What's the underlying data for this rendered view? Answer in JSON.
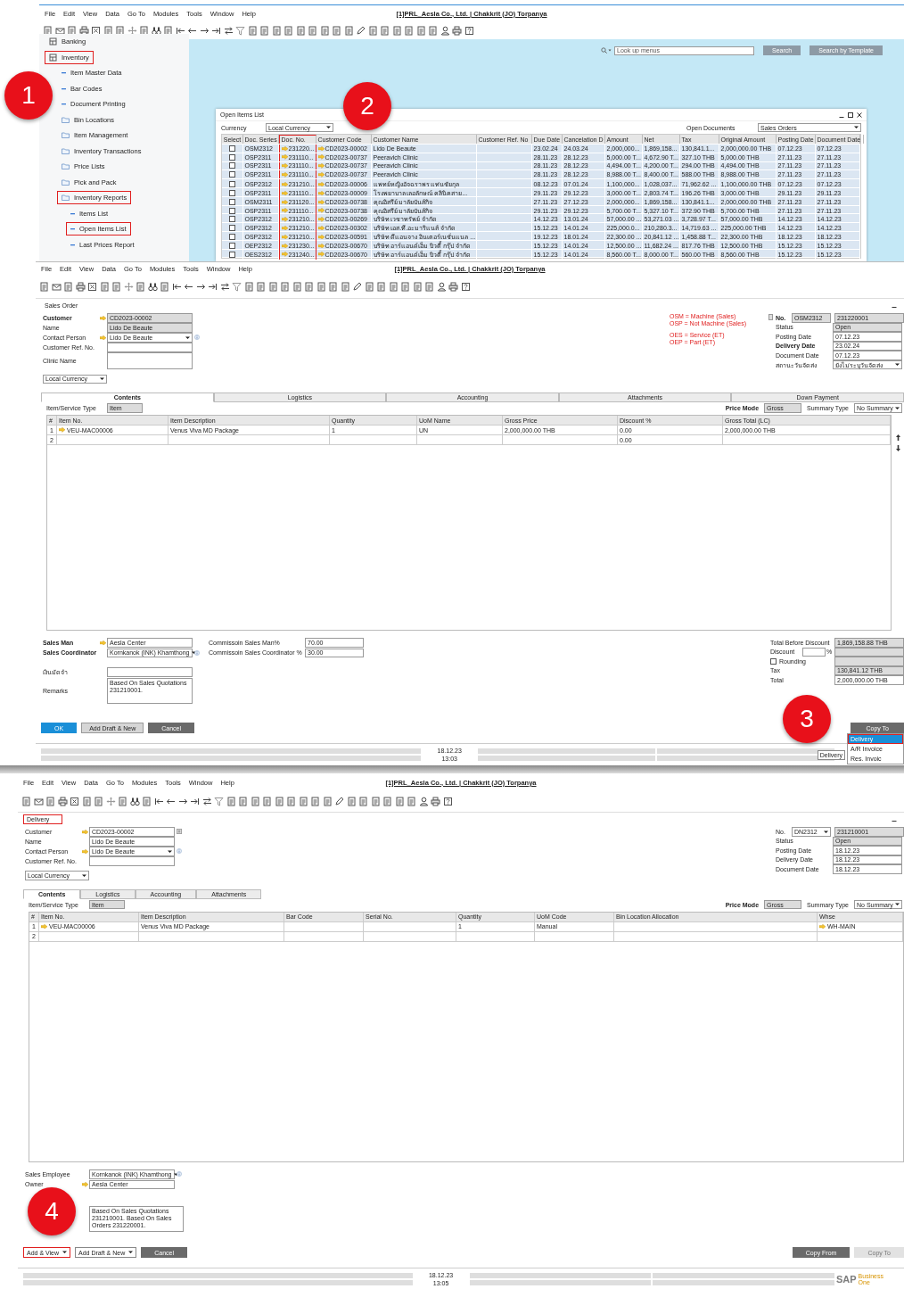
{
  "callouts": [
    {
      "text": "1"
    },
    {
      "text": "2"
    },
    {
      "text": "3"
    },
    {
      "text": "4"
    }
  ],
  "main_menu_screen": {
    "menu_bar": [
      "File",
      "Edit",
      "View",
      "Data",
      "Go To",
      "Modules",
      "Tools",
      "Window",
      "Help"
    ],
    "title": "[1]PRL_Aesla Co., Ltd. | Chakkrit (JO) Torpanya",
    "sidebar": {
      "items": [
        {
          "label": "Banking",
          "kind": "module",
          "highlighted": false
        },
        {
          "label": "Inventory",
          "kind": "module",
          "highlighted": true,
          "children": [
            {
              "label": "Item Master Data",
              "kind": "leaf",
              "highlighted": false
            },
            {
              "label": "Bar Codes",
              "kind": "leaf",
              "highlighted": false
            },
            {
              "label": "Document Printing",
              "kind": "leaf",
              "highlighted": false
            },
            {
              "label": "Bin Locations",
              "kind": "folder",
              "highlighted": false
            },
            {
              "label": "Item Management",
              "kind": "folder",
              "highlighted": false
            },
            {
              "label": "Inventory Transactions",
              "kind": "folder",
              "highlighted": false
            },
            {
              "label": "Price Lists",
              "kind": "folder",
              "highlighted": false
            },
            {
              "label": "Pick and Pack",
              "kind": "folder",
              "highlighted": false
            },
            {
              "label": "Inventory Reports",
              "kind": "folder",
              "highlighted": true,
              "children": [
                {
                  "label": "Items List",
                  "kind": "leaf",
                  "highlighted": false
                },
                {
                  "label": "Open Items List",
                  "kind": "leaf",
                  "highlighted": true
                },
                {
                  "label": "Last Prices Report",
                  "kind": "leaf",
                  "highlighted": false
                }
              ]
            }
          ]
        }
      ]
    },
    "search": {
      "placeholder": "Look up menus",
      "buttons": [
        "Search",
        "Search by Template"
      ]
    },
    "open_items_window": {
      "title": "Open Items List",
      "currency_label": "Currency",
      "currency": "Local Currency",
      "open_documents_label": "Open Documents",
      "open_documents": "Sales Orders",
      "columns": [
        {
          "label": "Select",
          "kind": "check",
          "highlighted": false
        },
        {
          "label": "Doc. Series",
          "kind": "text",
          "highlighted": false
        },
        {
          "label": "Doc. No.",
          "kind": "link",
          "highlighted": true
        },
        {
          "label": "Customer Code",
          "kind": "link",
          "highlighted": false
        },
        {
          "label": "Customer Name",
          "kind": "text",
          "highlighted": false
        },
        {
          "label": "Customer Ref. No",
          "kind": "text",
          "highlighted": false
        },
        {
          "label": "Due Date",
          "kind": "text",
          "highlighted": false
        },
        {
          "label": "Cancelation D",
          "kind": "text",
          "highlighted": false
        },
        {
          "label": "Amount",
          "kind": "text",
          "highlighted": false
        },
        {
          "label": "Net",
          "kind": "text",
          "highlighted": false
        },
        {
          "label": "Tax",
          "kind": "text",
          "highlighted": false
        },
        {
          "label": "Original Amount",
          "kind": "text",
          "highlighted": false
        },
        {
          "label": "Posting Date",
          "kind": "text",
          "highlighted": false
        },
        {
          "label": "Document Date",
          "kind": "text",
          "highlighted": false
        }
      ],
      "rows": [
        {
          "checked": false,
          "cells": [
            "",
            "OSM2312",
            "231220...",
            "CD2023-00002",
            "Lido De Beaute",
            "",
            "23.02.24",
            "24.03.24",
            "2,000,000...",
            "1,869,158...",
            "130,841.1...",
            "2,000,000.00 THB",
            "07.12.23",
            "07.12.23"
          ]
        },
        {
          "checked": false,
          "cells": [
            "",
            "OSP2311",
            "231110...",
            "CD2023-00737",
            "Peeravich Clinic",
            "",
            "28.11.23",
            "28.12.23",
            "5,000.00 T...",
            "4,672.90 T...",
            "327.10 THB",
            "5,000.00 THB",
            "27.11.23",
            "27.11.23"
          ]
        },
        {
          "checked": false,
          "cells": [
            "",
            "OSP2311",
            "231110...",
            "CD2023-00737",
            "Peeravich Clinic",
            "",
            "28.11.23",
            "28.12.23",
            "4,494.00 T...",
            "4,200.00 T...",
            "294.00 THB",
            "4,494.00 THB",
            "27.11.23",
            "27.11.23"
          ]
        },
        {
          "checked": false,
          "cells": [
            "",
            "OSP2311",
            "231110...",
            "CD2023-00737",
            "Peeravich Clinic",
            "",
            "28.11.23",
            "28.12.23",
            "8,988.00 T...",
            "8,400.00 T...",
            "588.00 THB",
            "8,988.00 THB",
            "27.11.23",
            "27.11.23"
          ]
        },
        {
          "checked": false,
          "cells": [
            "",
            "OSP2312",
            "231210...",
            "CD2023-00006",
            "แพทย์หญิงอัจฉราพร แท่นชัยกุล",
            "",
            "08.12.23",
            "07.01.24",
            "1,100,000...",
            "1,028,037...",
            "71,962.62 ...",
            "1,100,000.00 THB",
            "07.12.23",
            "07.12.23"
          ]
        },
        {
          "checked": false,
          "cells": [
            "",
            "OSP2311",
            "231110...",
            "CD2023-00009",
            "โรงพยาบาล เลอลักษณ์ คลินิคสาย...",
            "",
            "29.11.23",
            "29.12.23",
            "3,000.00 T...",
            "2,803.74 T...",
            "196.26 THB",
            "3,000.00 THB",
            "29.11.23",
            "29.11.23"
          ]
        },
        {
          "checked": false,
          "cells": [
            "",
            "OSM2311",
            "231120...",
            "CD2023-00738",
            "คุณอิสรีย์ มาลัยบันส์กิจ",
            "",
            "27.11.23",
            "27.12.23",
            "2,000,000...",
            "1,869,158...",
            "130,841.1...",
            "2,000,000.00 THB",
            "27.11.23",
            "27.11.23"
          ]
        },
        {
          "checked": false,
          "cells": [
            "",
            "OSP2311",
            "231110...",
            "CD2023-00738",
            "คุณอิสรีย์ มาลัยบันส์กิจ",
            "",
            "29.11.23",
            "29.12.23",
            "5,700.00 T...",
            "5,327.10 T...",
            "372.90 THB",
            "5,700.00 THB",
            "27.11.23",
            "27.11.23"
          ]
        },
        {
          "checked": false,
          "cells": [
            "",
            "OSP2312",
            "231210...",
            "CD2023-00269",
            "บริษัท เวชาทรัพย์ จำกัด",
            "",
            "14.12.23",
            "13.01.24",
            "57,000.00 ...",
            "53,271.03 ...",
            "3,728.97 T...",
            "57,000.00 THB",
            "14.12.23",
            "14.12.23"
          ]
        },
        {
          "checked": false,
          "cells": [
            "",
            "OSP2312",
            "231210...",
            "CD2023-00302",
            "บริษัท เอส.ที.อะมาริแนส์ จำกัด",
            "",
            "15.12.23",
            "14.01.24",
            "225,000.0...",
            "210,280.3...",
            "14,719.63 ...",
            "225,000.00 THB",
            "14.12.23",
            "14.12.23"
          ]
        },
        {
          "checked": false,
          "cells": [
            "",
            "OSP2312",
            "231210...",
            "CD2023-00591",
            "บริษัท ดีแอนจาง อินเตอร์เนชั่นแนล ...",
            "",
            "19.12.23",
            "18.01.24",
            "22,300.00 ...",
            "20,841.12 ...",
            "1,458.88 T...",
            "22,300.00 THB",
            "18.12.23",
            "18.12.23"
          ]
        },
        {
          "checked": false,
          "cells": [
            "",
            "OEP2312",
            "231230...",
            "CD2023-00670",
            "บริษัท อาร์แอนด์เอ็ม บิวตี้ กรุ๊ป จำกัด",
            "",
            "15.12.23",
            "14.01.24",
            "12,500.00 ...",
            "11,682.24 ...",
            "817.76 THB",
            "12,500.00 THB",
            "15.12.23",
            "15.12.23"
          ]
        },
        {
          "checked": false,
          "cells": [
            "",
            "OES2312",
            "231240...",
            "CD2023-00670",
            "บริษัท อาร์แอนด์เอ็ม บิวตี้ กรุ๊ป จำกัด",
            "",
            "15.12.23",
            "14.01.24",
            "8,560.00 T...",
            "8,000.00 T...",
            "560.00 THB",
            "8,560.00 THB",
            "15.12.23",
            "15.12.23"
          ]
        }
      ]
    }
  },
  "sales_order_screen": {
    "menu_bar": [
      "File",
      "Edit",
      "View",
      "Data",
      "Go To",
      "Modules",
      "Tools",
      "Window",
      "Help"
    ],
    "title": "[1]PRL_Aesla Co., Ltd. | Chakkrit (JO) Torpanya",
    "window_title": "Sales Order",
    "window_title_highlighted": false,
    "header_left": [
      {
        "label": "Customer",
        "bold": true,
        "kind": "link",
        "value": "CD2023-00002"
      },
      {
        "label": "Name",
        "bold": false,
        "kind": "display",
        "value": "Lido De Beaute"
      },
      {
        "label": "Contact Person",
        "bold": false,
        "kind": "link_dropdown",
        "value": "Lido De Beaute"
      },
      {
        "label": "Customer Ref. No.",
        "bold": false,
        "kind": "input"
      },
      {
        "label": "Clinic Name",
        "bold": false,
        "kind": "textarea"
      }
    ],
    "currency": "Local Currency",
    "notes": [
      {
        "text": "OSM = Machine (Sales)"
      },
      {
        "text": "OSP = Not Machine (Sales)"
      },
      {
        "text": "OES = Service (ET)"
      },
      {
        "text": "OEP = Part (ET)"
      }
    ],
    "header_right": [
      {
        "label": "No.",
        "bold": true,
        "kind": "series",
        "series": "OSM2312",
        "value": "231220001"
      },
      {
        "label": "Status",
        "bold": false,
        "kind": "display",
        "value": "Open"
      },
      {
        "label": "Posting Date",
        "bold": false,
        "kind": "input",
        "value": "07.12.23"
      },
      {
        "label": "Delivery Date",
        "bold": true,
        "kind": "input",
        "value": "23.02.24"
      },
      {
        "label": "Document Date",
        "bold": false,
        "kind": "input",
        "value": "07.12.23"
      },
      {
        "label": "สถานะวันจัดส่ง",
        "bold": false,
        "kind": "dropdown",
        "value": "ยังไม่ระบุวันจัดส่ง"
      }
    ],
    "tabs": [
      {
        "label": "Contents",
        "selected": true
      },
      {
        "label": "Logistics",
        "selected": false
      },
      {
        "label": "Accounting",
        "selected": false
      },
      {
        "label": "Attachments",
        "selected": false
      },
      {
        "label": "Down Payment",
        "selected": false
      }
    ],
    "item_type_label": "Item/Service Type",
    "item_type": "Item",
    "price_mode_label": "Price Mode",
    "price_mode": "Gross",
    "summary_type_label": "Summary Type",
    "summary_type": "No Summary",
    "grid": {
      "columns": [
        {
          "label": "#",
          "kind": "index"
        },
        {
          "label": "Item No.",
          "kind": "link"
        },
        {
          "label": "Item Description",
          "kind": "text"
        },
        {
          "label": "Quantity",
          "kind": "text"
        },
        {
          "label": "UoM Name",
          "kind": "text"
        },
        {
          "label": "Gross Price",
          "kind": "text"
        },
        {
          "label": "Discount %",
          "kind": "text"
        },
        {
          "label": "Gross Total (LC)",
          "kind": "text"
        }
      ],
      "rows": [
        [
          "1",
          "VEU-MAC00006",
          "Venus Viva MD Package",
          "1",
          "UN",
          "2,000,000.00 THB",
          "0.00",
          "2,000,000.00 THB"
        ],
        [
          "2",
          "",
          "",
          "",
          "",
          "",
          "0.00",
          ""
        ]
      ]
    },
    "footer_left": [
      {
        "label": "Sales Man",
        "bold": true,
        "kind": "link_input",
        "value": "Aesla Center"
      },
      {
        "label": "Sales Coordinator",
        "bold": true,
        "kind": "dropdown_info",
        "value": "Kornkanok (INK) Khamthong"
      },
      {
        "label": "เงินมัดจำ",
        "bold": false,
        "kind": "input"
      },
      {
        "label": "Remarks",
        "bold": false,
        "kind": "textarea",
        "value": "Based On Sales Quotations 231210001."
      }
    ],
    "footer_middle": [
      {
        "label": "Commissoin Sales Man%",
        "bold": false,
        "kind": "input",
        "value": "70.00"
      },
      {
        "label": "Commissoin Sales Coordinator %",
        "bold": false,
        "kind": "input",
        "value": "30.00"
      }
    ],
    "totals": [
      {
        "label": "Total Before Discount",
        "kind": "display",
        "value": "1,869,158.88 THB"
      },
      {
        "label": "Discount",
        "kind": "percent",
        "unit": "%"
      },
      {
        "label": "Rounding",
        "kind": "checkbox",
        "checked": false
      },
      {
        "label": "Tax",
        "kind": "display",
        "value": "130,841.12 THB"
      },
      {
        "label": "Total",
        "kind": "input",
        "value": "2,000,000.00 THB"
      }
    ],
    "buttons": [
      {
        "label": "OK",
        "kind": "primary",
        "highlighted": false
      },
      {
        "label": "Add Draft & New",
        "kind": "secondary",
        "highlighted": false
      },
      {
        "label": "Cancel",
        "kind": "dark",
        "highlighted": false
      }
    ],
    "right_buttons": [
      {
        "label": "Copy To",
        "kind": "dark",
        "disabled": false
      }
    ],
    "copy_to_menu": [
      {
        "label": "Delivery",
        "selected": true,
        "highlighted": true
      },
      {
        "label": "A/R Invoice",
        "selected": false,
        "highlighted": false
      },
      {
        "label": "Res. Invoic",
        "selected": false,
        "highlighted": false
      }
    ],
    "tooltip": "Delivery",
    "status_bar": {
      "date": "18.12.23",
      "time": "13:03"
    }
  },
  "delivery_screen": {
    "menu_bar": [
      "File",
      "Edit",
      "View",
      "Data",
      "Go To",
      "Modules",
      "Tools",
      "Window",
      "Help"
    ],
    "title": "[1]PRL_Aesla Co., Ltd. | Chakkrit (JO) Torpanya",
    "window_title": "Delivery",
    "window_title_highlighted": true,
    "header_left": [
      {
        "label": "Customer",
        "kind": "link_list",
        "value": "CD2023-00002"
      },
      {
        "label": "Name",
        "kind": "input",
        "value": "Lido De Beaute"
      },
      {
        "label": "Contact Person",
        "kind": "link_dropdown",
        "value": "Lido De Beaute"
      },
      {
        "label": "Customer Ref. No.",
        "kind": "input"
      }
    ],
    "currency": "Local Currency",
    "header_right": [
      {
        "label": "No.",
        "kind": "series_dropdown",
        "series": "DN2312",
        "value": "231210001"
      },
      {
        "label": "Status",
        "kind": "display",
        "value": "Open"
      },
      {
        "label": "Posting Date",
        "kind": "input",
        "value": "18.12.23"
      },
      {
        "label": "Delivery Date",
        "kind": "input",
        "value": "18.12.23"
      },
      {
        "label": "Document Date",
        "kind": "input",
        "value": "18.12.23"
      }
    ],
    "tabs": [
      {
        "label": "Contents",
        "selected": true
      },
      {
        "label": "Logistics",
        "selected": false
      },
      {
        "label": "Accounting",
        "selected": false
      },
      {
        "label": "Attachments",
        "selected": false
      }
    ],
    "item_type_label": "Item/Service Type",
    "item_type": "Item",
    "price_mode_label": "Price Mode",
    "price_mode": "Gross",
    "summary_type_label": "Summary Type",
    "summary_type": "No Summary",
    "grid": {
      "columns": [
        {
          "label": "#",
          "kind": "index"
        },
        {
          "label": "Item No.",
          "kind": "link"
        },
        {
          "label": "Item Description",
          "kind": "text"
        },
        {
          "label": "Bar Code",
          "kind": "text"
        },
        {
          "label": "Serial No.",
          "kind": "text"
        },
        {
          "label": "Quantity",
          "kind": "text"
        },
        {
          "label": "UoM Code",
          "kind": "text"
        },
        {
          "label": "Bin Location Allocation",
          "kind": "text"
        },
        {
          "label": "Whse",
          "kind": "link"
        }
      ],
      "rows": [
        [
          "1",
          "VEU-MAC00006",
          "Venus Viva MD Package",
          "",
          "",
          "1",
          "Manual",
          "",
          "WH-MAIN"
        ],
        [
          "2",
          "",
          "",
          "",
          "",
          "",
          "",
          "",
          ""
        ]
      ]
    },
    "footer_left": [
      {
        "label": "Sales Employee",
        "kind": "dropdown_info",
        "value": "Kornkanok (INK) Khamthong"
      },
      {
        "label": "Owner",
        "kind": "link_input",
        "value": "Aesla Center"
      },
      {
        "kind": "textarea",
        "value": "Based On Sales Quotations 231210001. Based On Sales Orders 231220001."
      }
    ],
    "buttons": [
      {
        "label": "Add & View",
        "kind": "split",
        "highlighted": true
      },
      {
        "label": "Add Draft & New",
        "kind": "split",
        "highlighted": false
      },
      {
        "label": "Cancel",
        "kind": "dark",
        "highlighted": false
      }
    ],
    "right_buttons": [
      {
        "label": "Copy From",
        "kind": "dark",
        "disabled": false
      },
      {
        "label": "Copy To",
        "kind": "dark",
        "disabled": true
      }
    ],
    "status_bar": {
      "date": "18.12.23",
      "time": "13:05"
    },
    "logo": {
      "text": "SAP",
      "sub": "Business One"
    }
  }
}
